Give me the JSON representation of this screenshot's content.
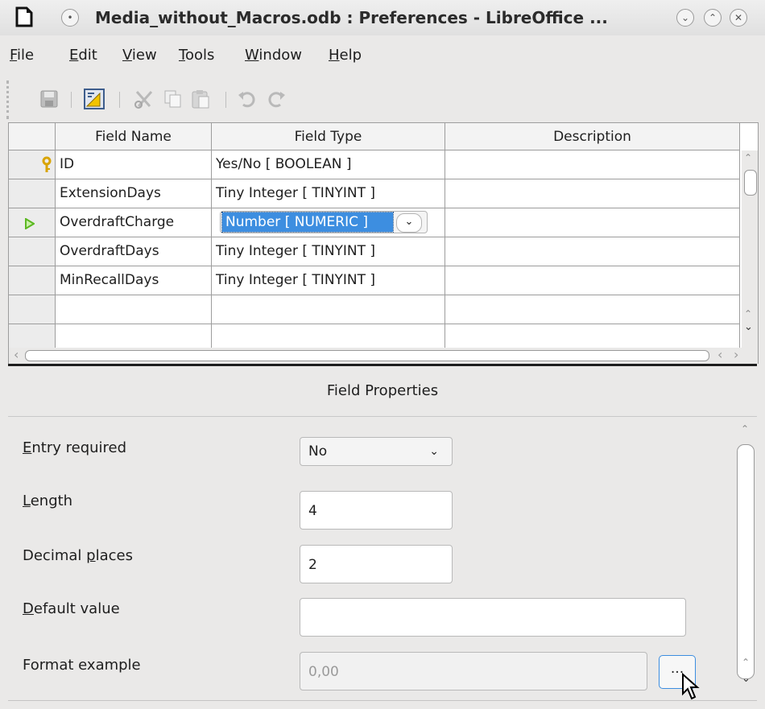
{
  "window": {
    "title": "Media_without_Macros.odb : Preferences - LibreOffice ..."
  },
  "menubar": [
    {
      "label": "File",
      "key": "F",
      "rest": "ile"
    },
    {
      "label": "Edit",
      "key": "E",
      "rest": "dit"
    },
    {
      "label": "View",
      "key": "V",
      "rest": "iew"
    },
    {
      "label": "Tools",
      "key": "T",
      "rest": "ools"
    },
    {
      "label": "Window",
      "key": "W",
      "rest": "indow"
    },
    {
      "label": "Help",
      "key": "H",
      "rest": "elp"
    }
  ],
  "toolbar": {
    "icons": [
      "save-icon",
      "design-icon",
      "cut-icon",
      "copy-icon",
      "paste-icon",
      "undo-icon",
      "redo-icon"
    ]
  },
  "table": {
    "headers": [
      "Field Name",
      "Field Type",
      "Description"
    ],
    "rows": [
      {
        "name": "ID",
        "type": "Yes/No [ BOOLEAN ]",
        "description": "",
        "marker": "primary-key-icon"
      },
      {
        "name": "ExtensionDays",
        "type": "Tiny Integer [ TINYINT ]",
        "description": "",
        "marker": ""
      },
      {
        "name": "OverdraftCharge",
        "type": "Number [ NUMERIC ]",
        "description": "",
        "marker": "current-row-icon"
      },
      {
        "name": "OverdraftDays",
        "type": "Tiny Integer [ TINYINT ]",
        "description": "",
        "marker": ""
      },
      {
        "name": "MinRecallDays",
        "type": "Tiny Integer [ TINYINT ]",
        "description": "",
        "marker": ""
      },
      {
        "name": "",
        "type": "",
        "description": "",
        "marker": ""
      }
    ]
  },
  "field_properties": {
    "title": "Field Properties",
    "entry_required": {
      "key": "E",
      "rest": "ntry required",
      "value": "No"
    },
    "length": {
      "key": "L",
      "rest": "ength",
      "value": "4"
    },
    "decimal_places": {
      "before": "Decimal ",
      "key": "p",
      "rest": "laces",
      "value": "2"
    },
    "default_value": {
      "key": "D",
      "rest": "efault value",
      "value": ""
    },
    "format_example": {
      "label": "Format example",
      "value": "0,00",
      "button_label": "..."
    }
  },
  "colors": {
    "selection": "#3d8ee0",
    "window_bg": "#eae9e8",
    "key_icon": "#d9a400",
    "arrow_icon": "#5cb822"
  }
}
